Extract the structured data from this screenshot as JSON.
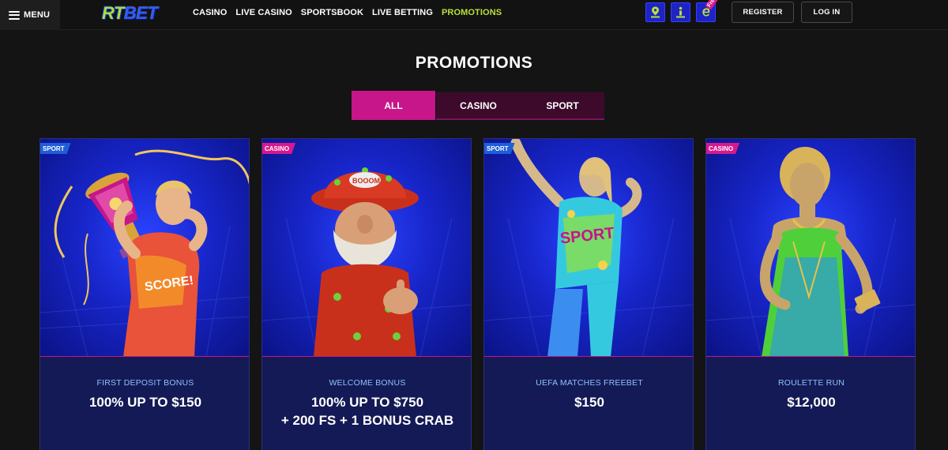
{
  "header": {
    "menu_label": "MENU",
    "logo_rt": "RT",
    "logo_bet": "BET",
    "nav": [
      {
        "label": "CASINO",
        "active": false
      },
      {
        "label": "LIVE CASINO",
        "active": false
      },
      {
        "label": "SPORTSBOOK",
        "active": false
      },
      {
        "label": "LIVE BETTING",
        "active": false
      },
      {
        "label": "PROMOTIONS",
        "active": true
      }
    ],
    "icons": [
      "location-icon",
      "info-icon",
      "freebet-icon"
    ],
    "free_tag": "Free",
    "register_label": "REGISTER",
    "login_label": "LOG IN"
  },
  "page_title": "PROMOTIONS",
  "tabs": [
    {
      "label": "ALL",
      "active": true
    },
    {
      "label": "CASINO",
      "active": false
    },
    {
      "label": "SPORT",
      "active": false
    }
  ],
  "cards": [
    {
      "badge": "SPORT",
      "subtitle": "FIRST DEPOSIT BONUS",
      "headline": "100% UP TO $150",
      "headline2": ""
    },
    {
      "badge": "CASINO",
      "subtitle": "WELCOME BONUS",
      "headline": "100% UP TO $750",
      "headline2": "+ 200 FS + 1 BONUS CRAB"
    },
    {
      "badge": "SPORT",
      "subtitle": "UEFA MATCHES FREEBET",
      "headline": "$150",
      "headline2": ""
    },
    {
      "badge": "CASINO",
      "subtitle": "ROULETTE RUN",
      "headline": "$12,000",
      "headline2": ""
    }
  ],
  "colors": {
    "accent_green": "#b7e23a",
    "accent_pink": "#c7158a",
    "card_blue": "#1725c8",
    "subtitle_blue": "#8cc2ff"
  }
}
